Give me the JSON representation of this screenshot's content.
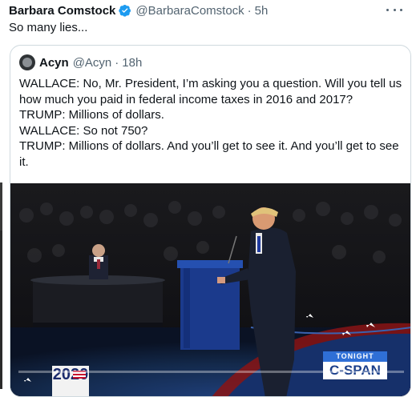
{
  "tweet": {
    "author_name": "Barbara Comstock",
    "verified_icon": "verified-badge-icon",
    "handle": "@BarbaraComstock",
    "separator": "·",
    "time": "5h",
    "text": "So many lies...",
    "more_icon": "more-horizontal-icon"
  },
  "quote": {
    "author_name": "Acyn",
    "handle": "@Acyn",
    "separator": "·",
    "time": "18h",
    "lines": [
      "WALLACE: No, Mr. President, I’m asking you a question. Will you tell us how much you paid in federal income taxes in 2016 and 2017?",
      "TRUMP: Millions of dollars.",
      "WALLACE: So not 750?",
      "TRUMP: Millions of dollars. And you’ll get to see it. And you’ll get to see it."
    ]
  },
  "video": {
    "logo_text": "2020",
    "network_badge_top": "TONIGHT",
    "network_name": "C-SPAN",
    "progress_fraction": 0.0,
    "colors": {
      "accent": "#1d9bf0",
      "stage_blue": "#13294b",
      "podium": "#1b3a8c"
    }
  }
}
